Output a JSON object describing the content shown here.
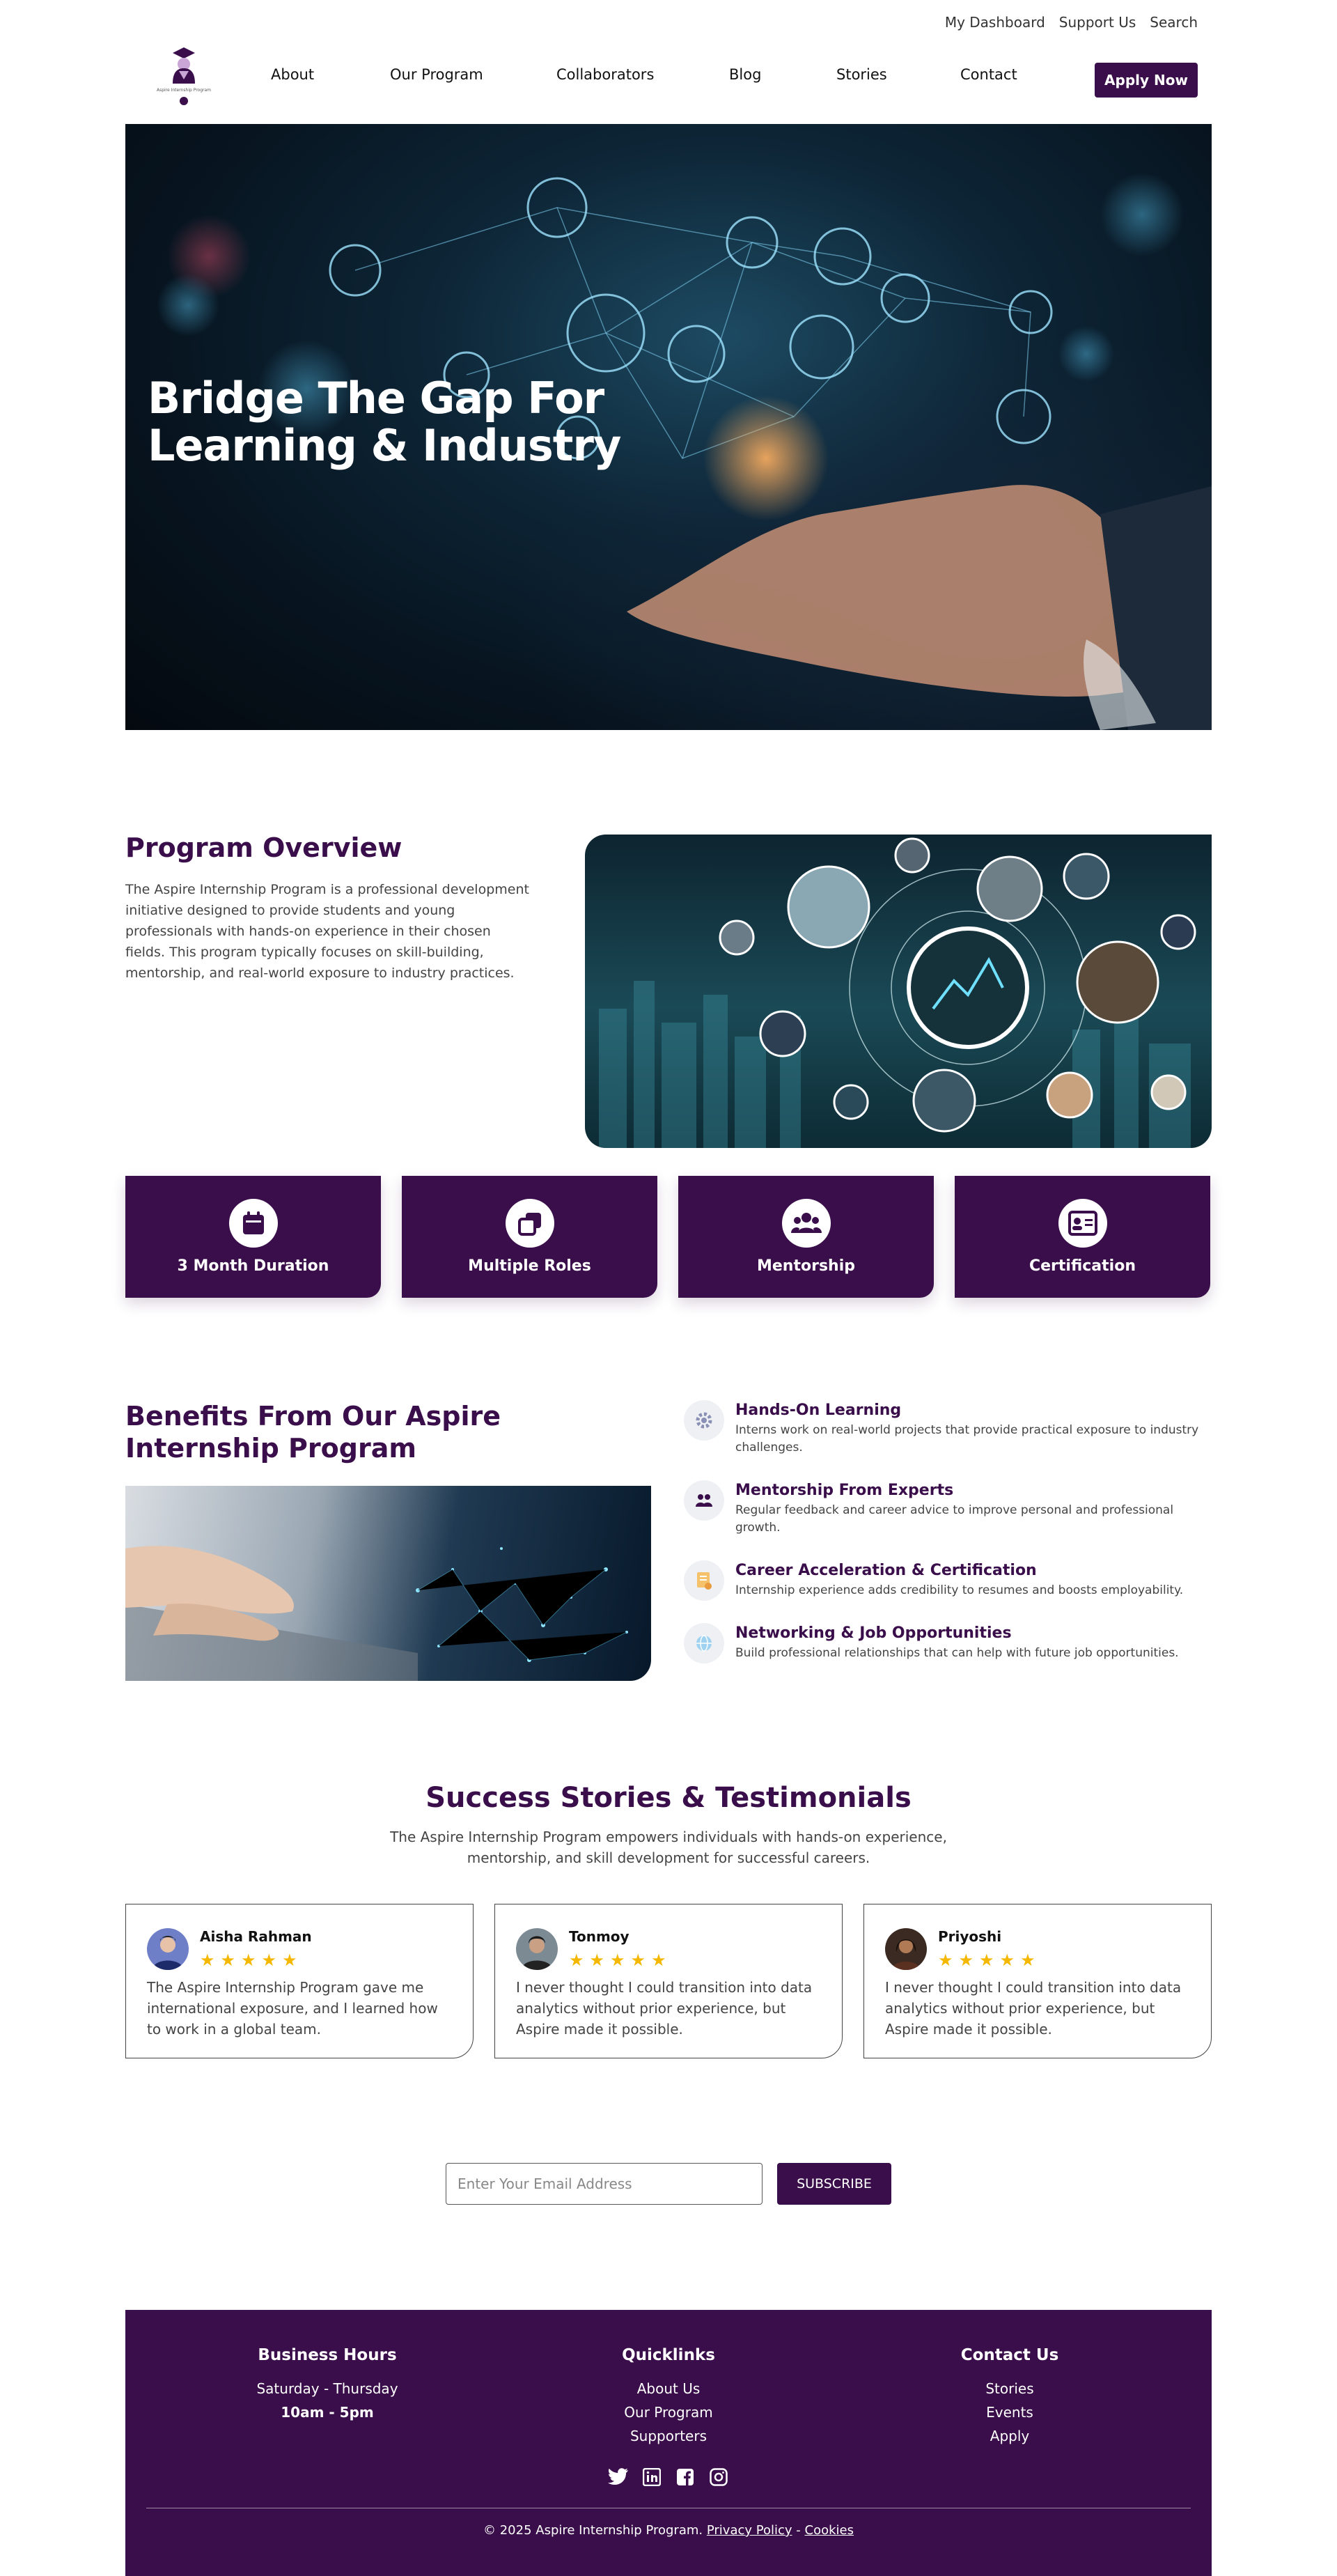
{
  "utility_nav": {
    "dashboard": "My Dashboard",
    "support": "Support Us",
    "search": "Search"
  },
  "logo": {
    "text": "Aspire Internship Program"
  },
  "nav": {
    "about": "About",
    "program": "Our Program",
    "collaborators": "Collaborators",
    "blog": "Blog",
    "stories": "Stories",
    "contact": "Contact",
    "apply": "Apply Now"
  },
  "hero": {
    "title_line1": "Bridge The Gap For",
    "title_line2": "Learning & Industry"
  },
  "overview": {
    "title": "Program Overview",
    "text": "The Aspire Internship Program is a professional development initiative designed to provide students and young professionals with hands-on experience in their chosen fields. This program typically focuses on skill-building, mentorship, and real-world exposure to industry practices."
  },
  "features": [
    {
      "label": "3 Month Duration",
      "icon": "calendar-icon"
    },
    {
      "label": "Multiple Roles",
      "icon": "layers-icon"
    },
    {
      "label": "Mentorship",
      "icon": "group-icon"
    },
    {
      "label": "Certification",
      "icon": "id-card-icon"
    }
  ],
  "benefits": {
    "title": "Benefits From Our Aspire Internship Program",
    "items": [
      {
        "title": "Hands-On Learning",
        "text": "Interns work on real-world projects that provide practical exposure to industry challenges.",
        "icon": "gear-icon"
      },
      {
        "title": "Mentorship From Experts",
        "text": "Regular feedback and career advice to improve personal and professional growth.",
        "icon": "people-icon"
      },
      {
        "title": "Career Acceleration & Certification",
        "text": "Internship experience adds credibility to resumes and boosts employability.",
        "icon": "certificate-icon"
      },
      {
        "title": "Networking & Job Opportunities",
        "text": "Build professional relationships that can help with future job opportunities.",
        "icon": "globe-icon"
      }
    ]
  },
  "testimonials": {
    "title": "Success Stories & Testimonials",
    "subtitle": "The Aspire Internship Program empowers individuals with hands-on experience, mentorship, and skill development for successful careers.",
    "cards": [
      {
        "name": "Aisha Rahman",
        "stars": "★★★★★",
        "rating": 5,
        "text": "The Aspire Internship Program gave me international exposure, and I learned how to work in a global team."
      },
      {
        "name": "Tonmoy",
        "stars": "★★★★★",
        "rating": 5,
        "text": "I never thought I could transition into data analytics without prior experience, but Aspire made it possible."
      },
      {
        "name": "Priyoshi",
        "stars": "★★★★★",
        "rating": 5,
        "text": "I never thought I could transition into data analytics without prior experience, but Aspire made it possible."
      }
    ]
  },
  "subscribe": {
    "placeholder": "Enter Your Email Address",
    "button": "SUBSCRIBE"
  },
  "footer": {
    "hours_title": "Business Hours",
    "hours_days": "Saturday - Thursday",
    "hours_time": "10am - 5pm",
    "quick_title": "Quicklinks",
    "quick_links": [
      "About Us",
      "Our Program",
      "Supporters"
    ],
    "contact_title": "Contact Us",
    "contact_links": [
      "Stories",
      "Events",
      "Apply"
    ],
    "copyright": "© 2025 Aspire Internship Program.",
    "privacy": "Privacy Policy",
    "separator": "-",
    "cookies": "Cookies"
  },
  "colors": {
    "brand": "#3a0e4a",
    "star": "#f5b800"
  }
}
